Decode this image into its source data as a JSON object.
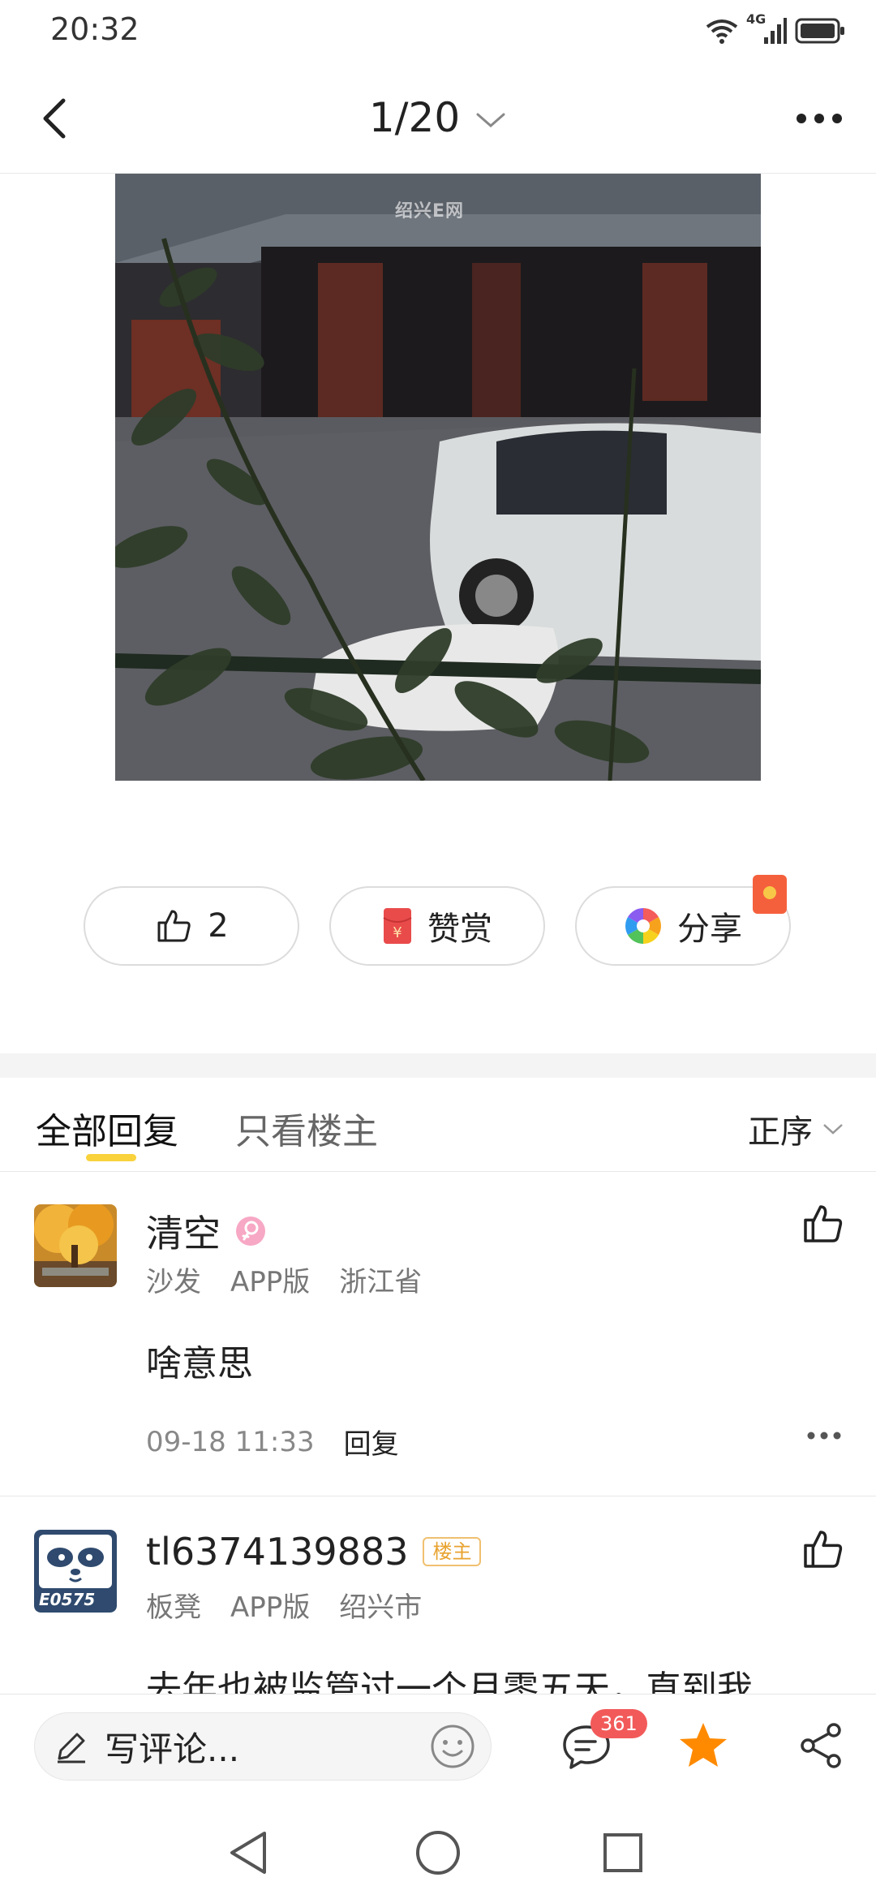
{
  "status_bar": {
    "time": "20:32",
    "network_label": "4G"
  },
  "nav": {
    "page_indicator": "1/20"
  },
  "photo": {
    "watermark": "绍兴E网"
  },
  "actions": {
    "like_count": "2",
    "reward_label": "赞赏",
    "share_label": "分享"
  },
  "tabs": {
    "all_replies": "全部回复",
    "owner_only": "只看楼主",
    "sort_label": "正序"
  },
  "comments": [
    {
      "username": "清空",
      "floor": "沙发",
      "client": "APP版",
      "location": "浙江省",
      "body": "啥意思",
      "time": "09-18 11:33",
      "reply_label": "回复"
    },
    {
      "username": "tl6374139883",
      "badge": "楼主",
      "floor": "板凳",
      "client": "APP版",
      "location": "绍兴市",
      "body": "去年也被监管过一个月零五天，直到我",
      "avatar_text": "E0575"
    }
  ],
  "bottom_bar": {
    "comment_placeholder": "写评论...",
    "comment_count": "361"
  },
  "colors": {
    "accent_yellow": "#f9d23c",
    "star_orange": "#ff8a00",
    "badge_red": "#f25a5a",
    "reward_red": "#e94b4b"
  }
}
